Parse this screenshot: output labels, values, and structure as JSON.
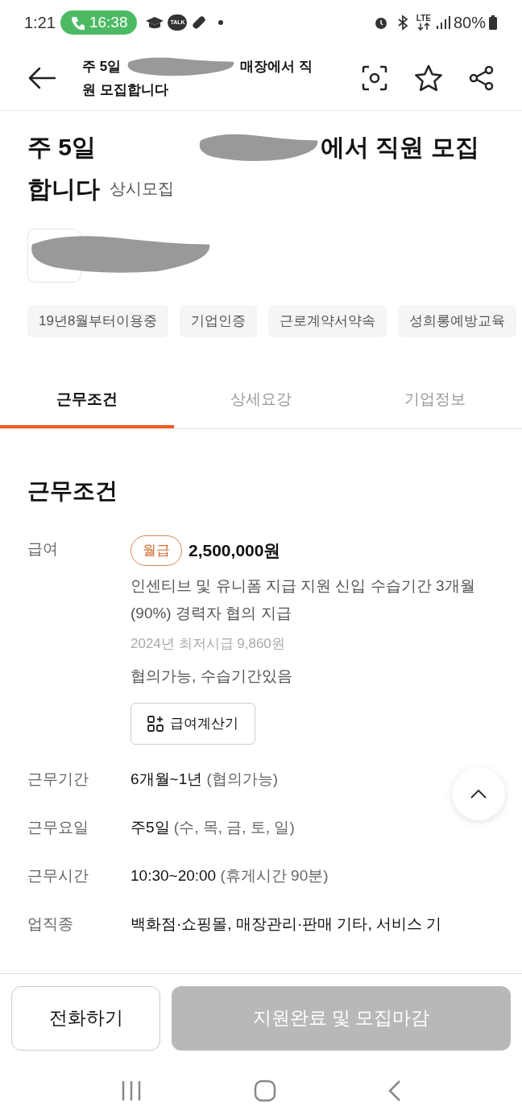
{
  "status_bar": {
    "time": "1:21",
    "call_timer": "16:38",
    "talk_label": "TALK",
    "network": "LTE",
    "battery": "80%"
  },
  "header": {
    "title_start": "주 5일",
    "title_end": "매장에서 직\n원 모집합니다"
  },
  "post": {
    "title_start": "주 5일",
    "title_end": "에서 직원 모집\n합니다",
    "recruit_type": "상시모집"
  },
  "tags": [
    "19년8월부터이용중",
    "기업인증",
    "근로계약서약속",
    "성희롱예방교육"
  ],
  "tabs": [
    {
      "label": "근무조건",
      "selected": true
    },
    {
      "label": "상세요강",
      "selected": false
    },
    {
      "label": "기업정보",
      "selected": false
    }
  ],
  "section_title": "근무조건",
  "salary": {
    "label": "급여",
    "pay_type": "월급",
    "amount": "2,500,000원",
    "description": "인센티브 및 유니폼 지급 지원 신입 수습기간 3개월(90%) 경력자 협의 지급",
    "minimum_wage": "2024년 최저시급 9,860원",
    "note": "협의가능, 수습기간있음",
    "calculator_button": "급여계산기"
  },
  "conditions": [
    {
      "label": "근무기간",
      "value": "6개월~1년",
      "note": "(협의가능)"
    },
    {
      "label": "근무요일",
      "value": "주5일",
      "note": "(수, 목, 금, 토, 일)"
    },
    {
      "label": "근무시간",
      "value": "10:30~20:00",
      "note": "(휴게시간 90분)"
    },
    {
      "label": "업직종",
      "value": "백화점·쇼핑몰, 매장관리·판매 기타, 서비스 기"
    }
  ],
  "bottom_bar": {
    "call_button": "전화하기",
    "apply_button": {
      "label": "지원완료 및 모집마감",
      "disabled": true
    }
  }
}
